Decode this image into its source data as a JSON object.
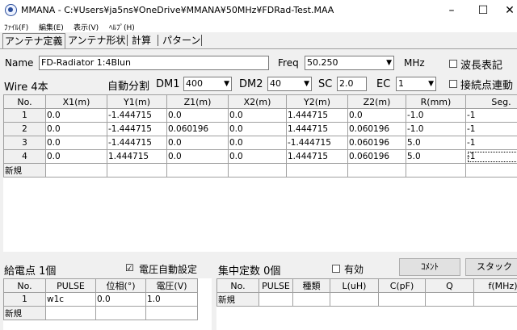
{
  "window": {
    "title": "MMANA - C:¥Users¥ja5ns¥OneDrive¥MMANA¥50MHz¥FDRad-Test.MAA",
    "minimize": "–",
    "maximize": "☐",
    "close": "✕"
  },
  "menu": {
    "file": "ﾌｧｲﾙ(F)",
    "edit": "編集(E)",
    "view": "表示(V)",
    "help": "ﾍﾙﾌﾟ(H)"
  },
  "tabs": [
    "アンテナ定義",
    "アンテナ形状",
    "計算",
    "パターン"
  ],
  "antenna": {
    "name_label": "Name",
    "name_value": "FD-Radiator 1:4Blun",
    "freq_label": "Freq",
    "freq_value": "50.250",
    "freq_unit": "MHz",
    "wavelength_label": "波長表記",
    "connect_label": "接続点連動"
  },
  "wire": {
    "count_label": "Wire 4本",
    "autosplit_label": "自動分割",
    "dm1_label": "DM1",
    "dm1_value": "400",
    "dm2_label": "DM2",
    "dm2_value": "40",
    "sc_label": "SC",
    "sc_value": "2.0",
    "ec_label": "EC",
    "ec_value": "1"
  },
  "wire_table": {
    "headers": [
      "No.",
      "X1(m)",
      "Y1(m)",
      "Z1(m)",
      "X2(m)",
      "Y2(m)",
      "Z2(m)",
      "R(mm)",
      "Seg."
    ],
    "rows": [
      [
        "1",
        "0.0",
        "-1.444715",
        "0.0",
        "0.0",
        "1.444715",
        "0.0",
        "-1.0",
        "-1"
      ],
      [
        "2",
        "0.0",
        "-1.444715",
        "0.060196",
        "0.0",
        "1.444715",
        "0.060196",
        "-1.0",
        "-1"
      ],
      [
        "3",
        "0.0",
        "-1.444715",
        "0.0",
        "0.0",
        "-1.444715",
        "0.060196",
        "5.0",
        "-1"
      ],
      [
        "4",
        "0.0",
        "1.444715",
        "0.0",
        "0.0",
        "1.444715",
        "0.060196",
        "5.0",
        "-1"
      ]
    ],
    "new_row": "新規"
  },
  "feed": {
    "count_label": "給電点 1個",
    "auto_voltage_label": "電圧自動設定",
    "headers": [
      "No.",
      "PULSE",
      "位相(°)",
      "電圧(V)"
    ],
    "rows": [
      [
        "1",
        "w1c",
        "0.0",
        "1.0"
      ]
    ],
    "new_row": "新規"
  },
  "load": {
    "count_label": "集中定数 0個",
    "enabled_label": "有効",
    "comment_button": "ｺﾒﾝﾄ",
    "stack_button": "スタック",
    "headers": [
      "No.",
      "PULSE",
      "種類",
      "L(uH)",
      "C(pF)",
      "Q",
      "f(MHz)"
    ],
    "new_row": "新規"
  }
}
